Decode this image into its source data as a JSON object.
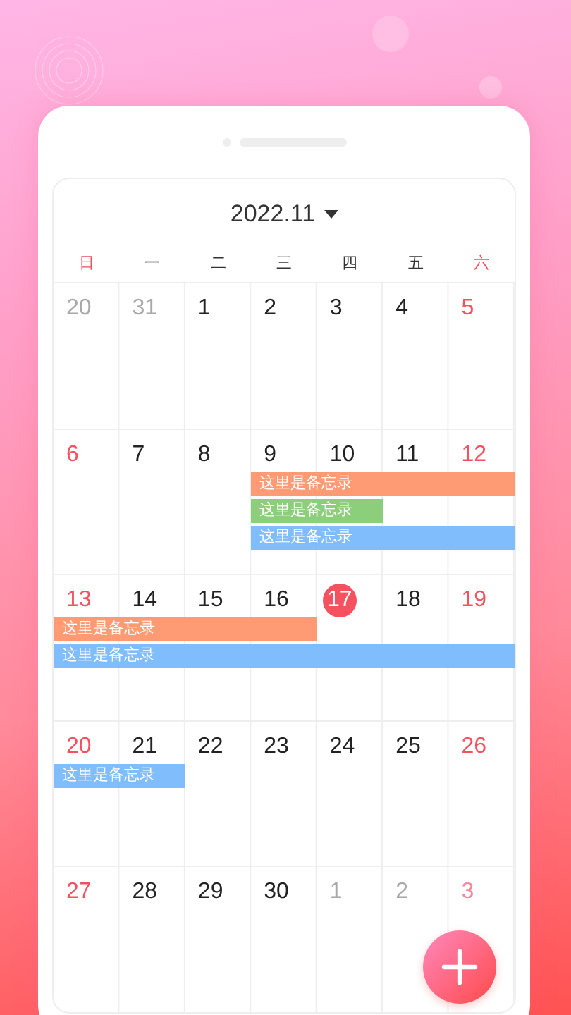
{
  "calendar": {
    "title": "2022.11",
    "weekdays": [
      {
        "label": "日",
        "weekend": true
      },
      {
        "label": "一",
        "weekend": false
      },
      {
        "label": "二",
        "weekend": false
      },
      {
        "label": "三",
        "weekend": false
      },
      {
        "label": "四",
        "weekend": false
      },
      {
        "label": "五",
        "weekend": false
      },
      {
        "label": "六",
        "weekend": true
      }
    ],
    "weeks": [
      {
        "days": [
          {
            "label": "20",
            "kind": "other",
            "today": false
          },
          {
            "label": "31",
            "kind": "other",
            "today": false
          },
          {
            "label": "1",
            "kind": "normal",
            "today": false
          },
          {
            "label": "2",
            "kind": "normal",
            "today": false
          },
          {
            "label": "3",
            "kind": "normal",
            "today": false
          },
          {
            "label": "4",
            "kind": "normal",
            "today": false
          },
          {
            "label": "5",
            "kind": "weekend",
            "today": false
          }
        ]
      },
      {
        "days": [
          {
            "label": "6",
            "kind": "weekend",
            "today": false
          },
          {
            "label": "7",
            "kind": "normal",
            "today": false
          },
          {
            "label": "8",
            "kind": "normal",
            "today": false
          },
          {
            "label": "9",
            "kind": "normal",
            "today": false
          },
          {
            "label": "10",
            "kind": "normal",
            "today": false
          },
          {
            "label": "11",
            "kind": "normal",
            "today": false
          },
          {
            "label": "12",
            "kind": "weekend",
            "today": false
          }
        ],
        "events": [
          {
            "text": "这里是备忘录",
            "color": "#ff9b74",
            "kind": "wed-sat"
          },
          {
            "text": "这里是备忘录",
            "color": "#8ccf7a",
            "kind": "wed-thu"
          },
          {
            "text": "这里是备忘录",
            "color": "#80bdfc",
            "kind": "wed-sat"
          }
        ]
      },
      {
        "days": [
          {
            "label": "13",
            "kind": "weekend",
            "today": false
          },
          {
            "label": "14",
            "kind": "normal",
            "today": false
          },
          {
            "label": "15",
            "kind": "normal",
            "today": false
          },
          {
            "label": "16",
            "kind": "normal",
            "today": false
          },
          {
            "label": "17",
            "today": true
          },
          {
            "label": "18",
            "kind": "normal",
            "today": false
          },
          {
            "label": "19",
            "kind": "weekend",
            "today": false
          }
        ],
        "events": [
          {
            "text": "这里是备忘录",
            "color": "#ff9b74",
            "kind": "sun-wed"
          },
          {
            "text": "这里是备忘录",
            "color": "#80bdfc",
            "kind": "sun-sat"
          }
        ]
      },
      {
        "days": [
          {
            "label": "20",
            "kind": "weekend",
            "today": false
          },
          {
            "label": "21",
            "kind": "normal",
            "today": false
          },
          {
            "label": "22",
            "kind": "normal",
            "today": false
          },
          {
            "label": "23",
            "kind": "normal",
            "today": false
          },
          {
            "label": "24",
            "kind": "normal",
            "today": false
          },
          {
            "label": "25",
            "kind": "normal",
            "today": false
          },
          {
            "label": "26",
            "kind": "weekend",
            "today": false
          }
        ],
        "events": [
          {
            "text": "这里是备忘录",
            "color": "#80bdfc",
            "kind": "sun-mon"
          }
        ]
      },
      {
        "days": [
          {
            "label": "27",
            "kind": "weekend",
            "today": false
          },
          {
            "label": "28",
            "kind": "normal",
            "today": false
          },
          {
            "label": "29",
            "kind": "normal",
            "today": false
          },
          {
            "label": "30",
            "kind": "normal",
            "today": false
          },
          {
            "label": "1",
            "kind": "other",
            "today": false
          },
          {
            "label": "2",
            "kind": "other",
            "today": false
          },
          {
            "label": "3",
            "kind": "other-weekend",
            "today": false
          }
        ]
      }
    ]
  }
}
